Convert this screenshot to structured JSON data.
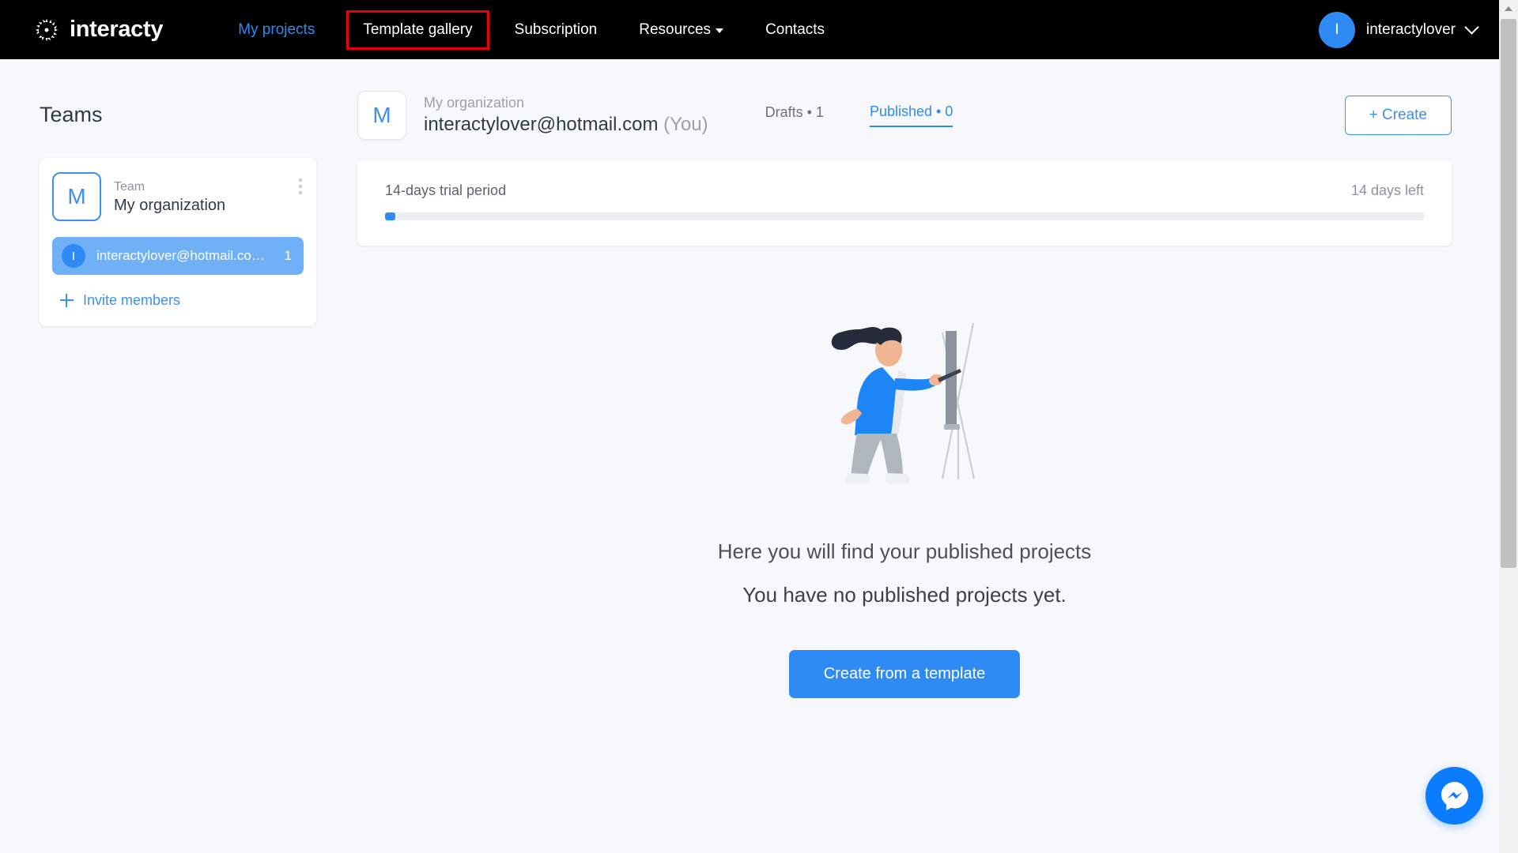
{
  "topnav": {
    "brand": "interacty",
    "brand_icon": "interacty-sunburst-logo-icon",
    "links": [
      {
        "label": "My projects",
        "state": "active-blue"
      },
      {
        "label": "Template gallery",
        "state": "highlighted"
      },
      {
        "label": "Subscription",
        "state": "normal"
      },
      {
        "label": "Resources",
        "state": "dropdown"
      },
      {
        "label": "Contacts",
        "state": "normal"
      }
    ],
    "user": {
      "initial": "I",
      "name": "interactylover",
      "chevron_icon": "chevron-down-icon"
    }
  },
  "sidebar": {
    "title": "Teams",
    "team": {
      "logo_initial": "M",
      "label": "Team",
      "name": "My organization",
      "menu_icon": "kebab-menu-icon"
    },
    "member": {
      "initial": "I",
      "email": "interactylover@hotmail.com…",
      "count": "1"
    },
    "invite": {
      "icon": "plus-icon",
      "label": "Invite members"
    }
  },
  "main": {
    "org": {
      "logo_initial": "M",
      "label": "My organization",
      "email": "interactylover@hotmail.com",
      "you_suffix": "(You)"
    },
    "tabs": [
      {
        "label": "Drafts • 1",
        "active": false
      },
      {
        "label": "Published  • 0",
        "active": true
      }
    ],
    "create_button": "+ Create",
    "trial": {
      "label": "14-days trial period",
      "days_left": "14 days left",
      "progress_percent": 1
    },
    "empty_state": {
      "illustration": "woman-painting-at-easel-illustration",
      "line1": "Here you will find your published projects",
      "line2": "You have no published projects yet.",
      "button": "Create from a template"
    }
  },
  "fab": {
    "icon": "messenger-icon",
    "label": "Messenger chat"
  },
  "scrollbar": {
    "icon": "scroll-up-arrow-icon"
  },
  "colors": {
    "brand_blue": "#2e8bf5",
    "highlight_red": "#e8000d",
    "nav_black": "#000000",
    "page_bg": "#f7f8fc",
    "messenger_blue": "#0a7cff"
  }
}
